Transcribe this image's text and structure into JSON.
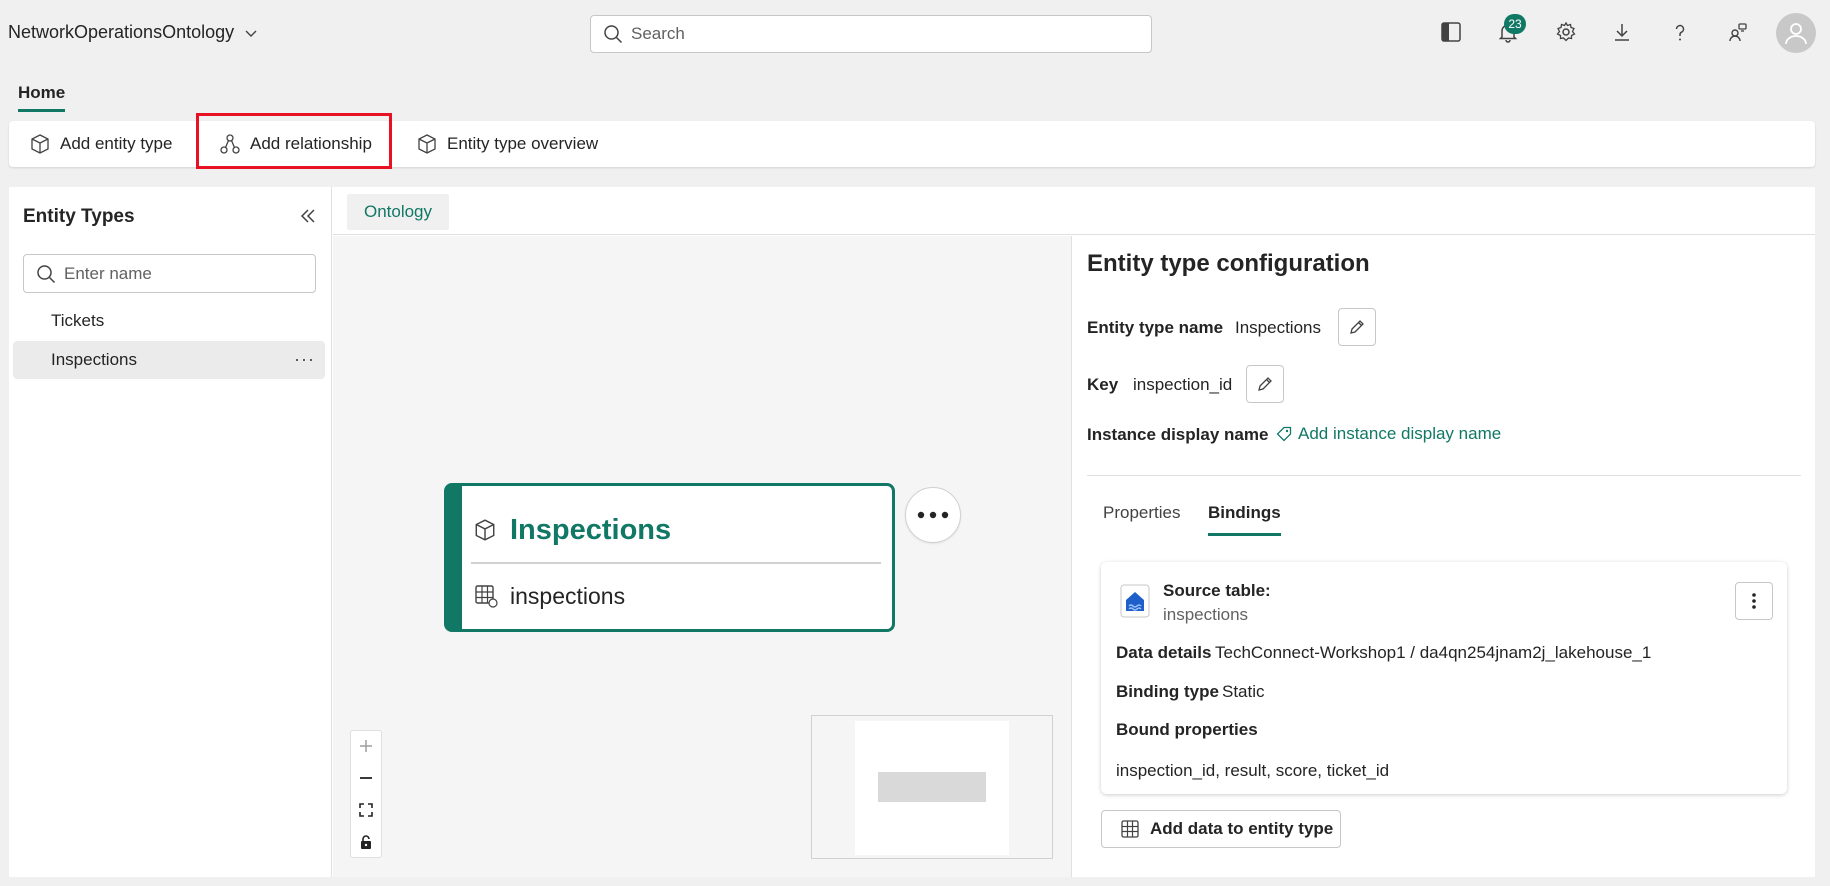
{
  "header": {
    "app_title": "NetworkOperationsOntology",
    "search_placeholder": "Search",
    "notification_count": "23"
  },
  "nav": {
    "home_tab": "Home"
  },
  "toolbar": {
    "add_entity_type": "Add entity type",
    "add_relationship": "Add relationship",
    "entity_type_overview": "Entity type overview"
  },
  "left_panel": {
    "title": "Entity Types",
    "filter_placeholder": "Enter name",
    "items": [
      {
        "label": "Tickets"
      },
      {
        "label": "Inspections",
        "more": "···"
      }
    ]
  },
  "center": {
    "tab": "Ontology",
    "node": {
      "title": "Inspections",
      "table": "inspections"
    }
  },
  "config": {
    "title": "Entity type configuration",
    "name_label": "Entity type name",
    "name_value": "Inspections",
    "key_label": "Key",
    "key_value": "inspection_id",
    "display_label": "Instance display name",
    "add_display": "Add instance display name",
    "tabs": {
      "properties": "Properties",
      "bindings": "Bindings"
    },
    "binding": {
      "source_label": "Source table:",
      "source_value": "inspections",
      "details_label": "Data details",
      "details_value": "TechConnect-Workshop1 / da4qn254jnam2j_lakehouse_1",
      "type_label": "Binding type",
      "type_value": "Static",
      "bound_label": "Bound properties",
      "bound_value": "inspection_id, result, score, ticket_id"
    },
    "add_data": "Add data to entity type"
  },
  "colors": {
    "accent": "#117865",
    "highlight": "#e81123"
  }
}
